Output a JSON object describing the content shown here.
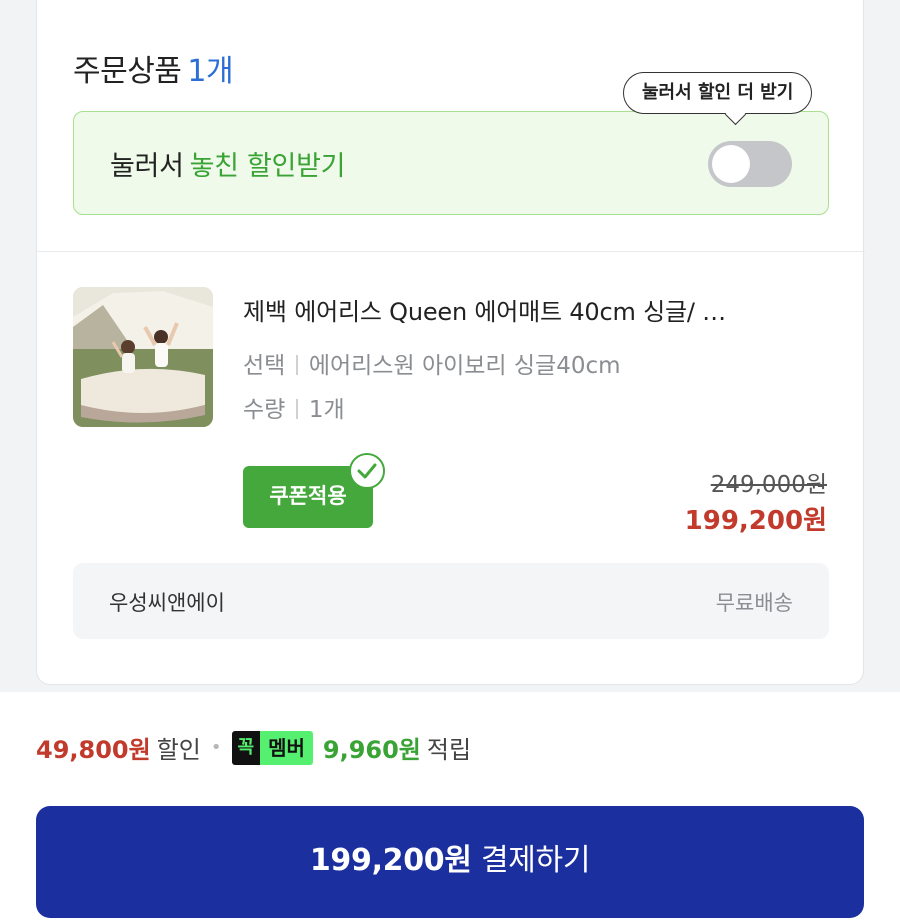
{
  "order": {
    "title": "주문상품",
    "count": "1개"
  },
  "tooltip": {
    "text": "눌러서 할인 더 받기"
  },
  "discount_toggle": {
    "label_prefix": "눌러서",
    "label_accent": "놓친 할인받기",
    "enabled": false
  },
  "product": {
    "name": "제백 에어리스 Queen 에어매트 40cm 싱글/ …",
    "option_label": "선택",
    "option_value": "에어리스원 아이보리 싱글40cm",
    "qty_label": "수량",
    "qty_value": "1개",
    "coupon_label": "쿠폰적용",
    "price_original": "249,000원",
    "price_sale": "199,200원"
  },
  "seller": {
    "name": "우성씨앤에이",
    "shipping": "무료배송"
  },
  "summary": {
    "discount_amount": "49,800원",
    "discount_suffix": "할인",
    "member_badge_left": "꼭",
    "member_badge_right": "멤버",
    "points_amount": "9,960원",
    "points_suffix": "적립"
  },
  "pay": {
    "amount": "199,200원",
    "label": "결제하기"
  },
  "colors": {
    "accent_green": "#3aa335",
    "price_red": "#c23a2c",
    "pay_blue": "#1b2f9e",
    "title_blue": "#2b6fd6"
  }
}
